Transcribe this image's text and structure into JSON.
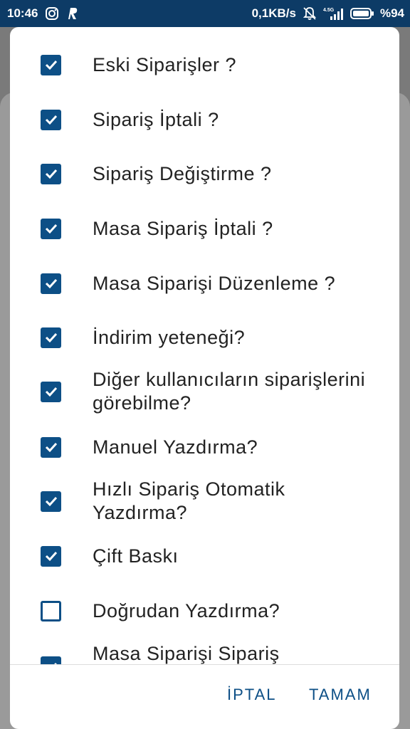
{
  "status_bar": {
    "time": "10:46",
    "network_speed": "0,1KB/s",
    "network_type": "4.5G",
    "battery": "%94",
    "icons": [
      "instagram-icon",
      "r-app-icon",
      "notifications-off-icon",
      "signal-icon",
      "battery-icon"
    ]
  },
  "dialog": {
    "items": [
      {
        "label": "Eski Siparişler ?",
        "checked": true
      },
      {
        "label": "Sipariş İptali ?",
        "checked": true
      },
      {
        "label": "Sipariş Değiştirme ?",
        "checked": true
      },
      {
        "label": "Masa Sipariş İptali ?",
        "checked": true
      },
      {
        "label": "Masa Siparişi Düzenleme ?",
        "checked": true
      },
      {
        "label": "İndirim yeteneği?",
        "checked": true
      },
      {
        "label": "Diğer kullanıcıların siparişlerini görebilme?",
        "checked": true
      },
      {
        "label": "Manuel Yazdırma?",
        "checked": true
      },
      {
        "label": "Hızlı Sipariş Otomatik Yazdırma?",
        "checked": true
      },
      {
        "label": "Çift Baskı",
        "checked": true
      },
      {
        "label": "Doğrudan Yazdırma?",
        "checked": false
      },
      {
        "label": "Masa Siparişi Sipariş",
        "checked": true
      }
    ],
    "cancel_label": "İPTAL",
    "ok_label": "TAMAM"
  },
  "colors": {
    "status_bar_bg": "#0d3b66",
    "accent": "#0d4f86",
    "scrim": "#7a7a7a"
  }
}
